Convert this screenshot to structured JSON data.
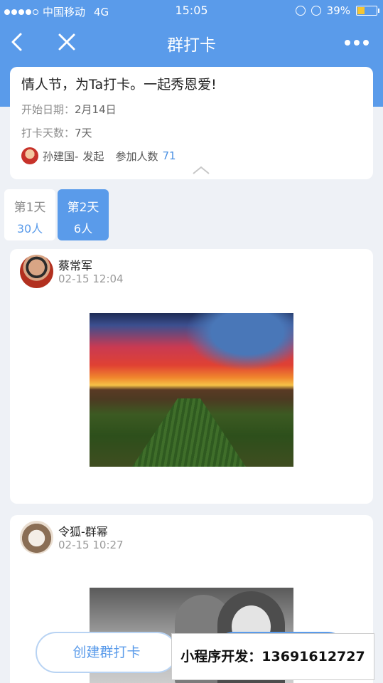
{
  "status_bar": {
    "carrier": "中国移动",
    "network": "4G",
    "time": "15:05",
    "battery": "39%",
    "battery_level": 0.39
  },
  "nav": {
    "title": "群打卡"
  },
  "info": {
    "title": "情人节，为Ta打卡。一起秀恩爱!",
    "start_label": "开始日期：",
    "start_value": "2月14日",
    "days_label": "打卡天数：",
    "days_value": "7天",
    "creator": "孙建国-",
    "initiated": "发起",
    "participants_label": "参加人数",
    "participants_count": "71"
  },
  "days": [
    {
      "label": "第1天",
      "count": "30人",
      "active": false
    },
    {
      "label": "第2天",
      "count": "6人",
      "active": true
    }
  ],
  "posts": [
    {
      "name": "蔡常军",
      "time": "02-15 12:04"
    },
    {
      "name": "令狐-群幂",
      "time": "02-15 10:27"
    }
  ],
  "create_button": "创建群打卡",
  "ad_text": "小程序开发：13691612727",
  "colors": {
    "accent": "#5a9bea",
    "battery": "#f6c531"
  }
}
